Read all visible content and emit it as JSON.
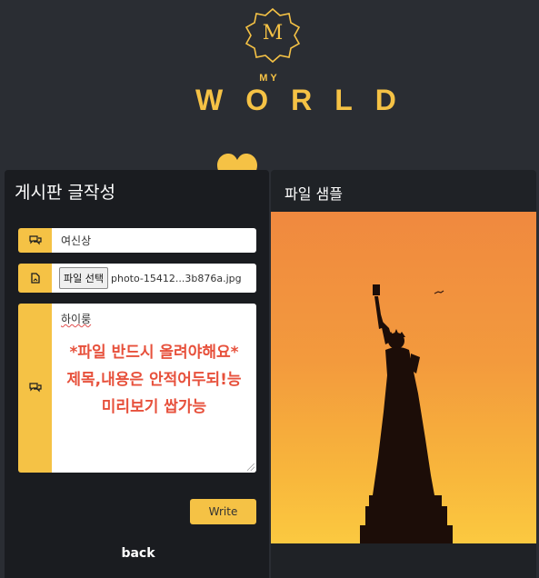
{
  "logo": {
    "badge_letter": "M",
    "small_text": "MY",
    "big_text": "WORLD",
    "color": "#f5c245"
  },
  "left_panel": {
    "title": "게시판 글작성",
    "title_field": {
      "value": "여신상",
      "icon": "chat-bubbles-icon"
    },
    "file_field": {
      "button_label": "파일 선택",
      "file_name": "photo-15412...3b876a.jpg",
      "icon": "file-image-icon"
    },
    "content_field": {
      "first_line": "하이룽",
      "warning_lines": [
        "*파일 반드시 올려야해요*",
        "제목,내용은 안적어두되!능",
        "미리보기 쌉가능"
      ],
      "icon": "chat-bubbles-icon"
    },
    "write_button": "Write",
    "back_link": "back"
  },
  "right_panel": {
    "title": "파일 샘플",
    "image": "statue-of-liberty-sunset"
  },
  "colors": {
    "accent": "#f5c245",
    "background": "#2a2d33",
    "panel": "#1a1c20",
    "warning_text": "#e7513c"
  }
}
